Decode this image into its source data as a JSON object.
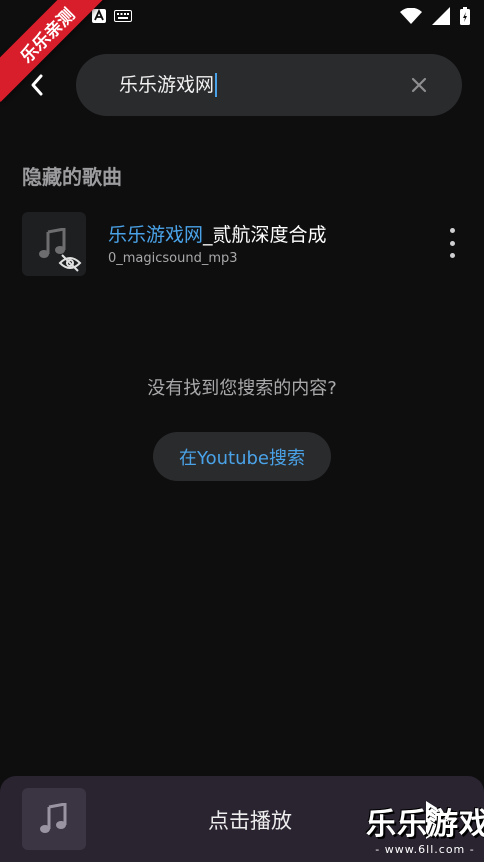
{
  "status_bar": {
    "left_icons": [
      "a-notification-icon",
      "keyboard-icon"
    ],
    "right_icons": [
      "wifi-icon",
      "signal-icon",
      "battery-icon"
    ]
  },
  "ribbon": {
    "text": "乐乐亲测"
  },
  "search": {
    "value": "乐乐游戏网"
  },
  "section": {
    "title": "隐藏的歌曲"
  },
  "songs": [
    {
      "title_highlight": "乐乐游戏网",
      "title_rest": "_贰航深度合成",
      "subtitle": "0_magicsound_mp3",
      "hidden": true
    }
  ],
  "empty": {
    "message": "没有找到您搜索的内容?",
    "button_label": "在Youtube搜索"
  },
  "player": {
    "label": "点击播放"
  },
  "watermark": {
    "main": "乐乐游戏",
    "sub": "- www.6ll.com -"
  },
  "colors": {
    "accent": "#4aa3e8",
    "background": "#0e0e0f",
    "surface": "#2a2b2d",
    "ribbon": "#d81e2a",
    "player": "#2a2330"
  }
}
